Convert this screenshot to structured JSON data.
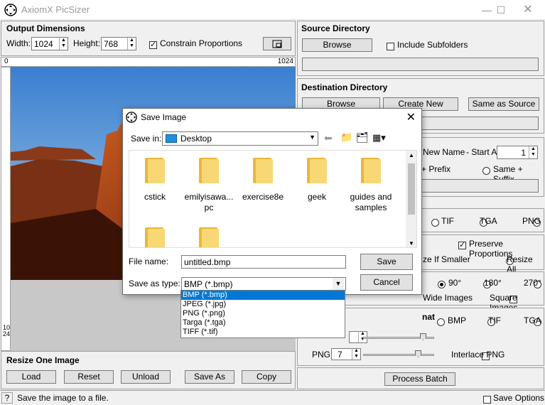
{
  "window": {
    "title": "AxiomX PicSizer"
  },
  "output_dims": {
    "title": "Output Dimensions",
    "width_label": "Width:",
    "width_value": "1024",
    "height_label": "Height:",
    "height_value": "768",
    "constrain_label": "Constrain Proportions"
  },
  "ruler": {
    "start": "0",
    "end": "1024",
    "vertical": "1024"
  },
  "resize_one": {
    "title": "Resize One Image",
    "load": "Load",
    "reset": "Reset",
    "unload": "Unload",
    "save_as": "Save As",
    "copy": "Copy"
  },
  "status": {
    "help": "?",
    "text": "Save the image to a file.",
    "save_options": "Save Options"
  },
  "source_dir": {
    "title": "Source Directory",
    "browse": "Browse",
    "include_sub": "Include Subfolders"
  },
  "dest_dir": {
    "title": "Destination Directory",
    "browse": "Browse",
    "create_new": "Create New",
    "same_as_source": "Same as Source"
  },
  "naming": {
    "new_name": "New Name",
    "start_at_label": "- Start At:",
    "start_at_value": "1",
    "prefix": "+ Prefix",
    "same_suffix": "Same + Suffix"
  },
  "formats_row1": {
    "tif": "TIF",
    "tga": "TGA",
    "png": "PNG"
  },
  "resize_opts": {
    "preserve": "Preserve Proportions",
    "if_smaller": "ze If Smaller",
    "resize_all": "Resize All"
  },
  "rotation": {
    "r90": "90°",
    "r180": "180°",
    "r270": "270°",
    "wide": "Wide Images",
    "square": "Square Images"
  },
  "output_format": {
    "title_partial": "nat",
    "bmp": "BMP",
    "tif": "TIF",
    "tga": "TGA",
    "png": "PNG",
    "png_level": "7",
    "interlace": "Interlace PNG"
  },
  "process_batch": "Process Batch",
  "save_dialog": {
    "title": "Save Image",
    "save_in_label": "Save in:",
    "save_in_value": "Desktop",
    "folders": [
      "cstick",
      "emilyisawa... pc",
      "exercise8e",
      "geek",
      "guides and samples",
      "",
      ""
    ],
    "file_name_label": "File name:",
    "file_name_value": "untitled.bmp",
    "save_type_label": "Save as type:",
    "save_type_value": "BMP (*.bmp)",
    "save_button": "Save",
    "cancel_button": "Cancel",
    "type_options": [
      "BMP (*.bmp)",
      "JPEG (*.jpg)",
      "PNG (*.png)",
      "Targa (*.tga)",
      "TIFF (*.tif)"
    ]
  }
}
